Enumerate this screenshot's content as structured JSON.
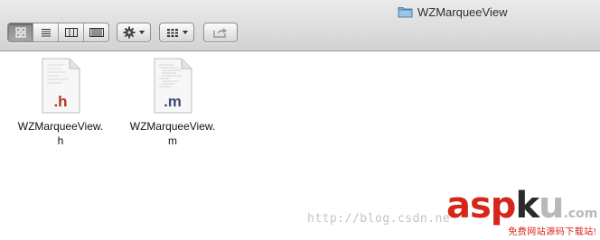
{
  "window": {
    "title": "WZMarqueeView"
  },
  "toolbar": {
    "view_buttons": [
      "icon-view-icon",
      "list-view-icon",
      "column-view-icon",
      "cover-flow-icon"
    ],
    "action": "gear-icon",
    "arrange": "grid-icon",
    "share": "share-icon"
  },
  "files": [
    {
      "ext": ".h",
      "name_line1": "WZMarqueeView.",
      "name_line2": "h",
      "ext_color": "#b0381d"
    },
    {
      "ext": ".m",
      "name_line1": "WZMarqueeView.",
      "name_line2": "m",
      "ext_color": "#3b4a72"
    }
  ],
  "watermark": {
    "url_text": "http://blog.csdn.ne",
    "logo_a": "asp",
    "logo_b": "k",
    "logo_c": "u",
    "logo_suffix": ".com",
    "tagline": "免费网站源码下载站!"
  }
}
